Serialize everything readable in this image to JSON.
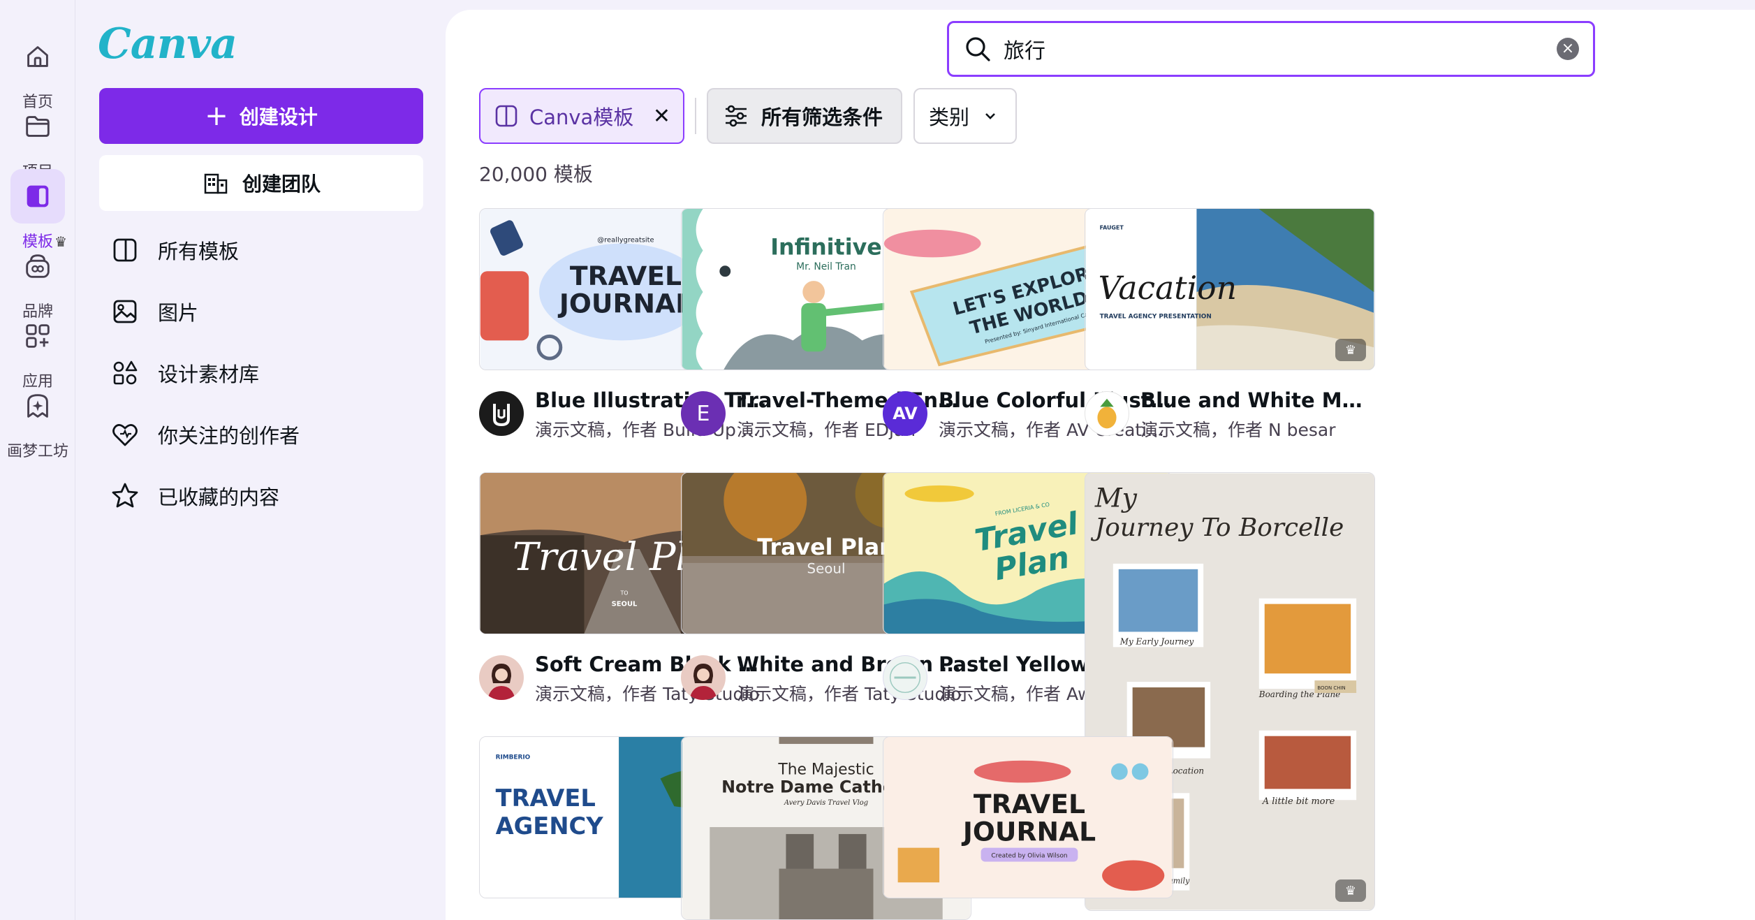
{
  "rail": {
    "items": [
      {
        "label": "首页",
        "icon": "home-icon"
      },
      {
        "label": "项目",
        "icon": "folder-icon"
      },
      {
        "label": "模板",
        "icon": "templates-icon",
        "active": true
      },
      {
        "label": "品牌",
        "icon": "brand-icon",
        "crown": true
      },
      {
        "label": "应用",
        "icon": "apps-icon"
      },
      {
        "label": "画梦工坊",
        "icon": "dream-lab-icon"
      }
    ]
  },
  "sidebar": {
    "logo": "Canva",
    "create_design": "创建设计",
    "create_team": "创建团队",
    "nav": [
      {
        "label": "所有模板",
        "icon": "templates-outline-icon"
      },
      {
        "label": "图片",
        "icon": "image-icon"
      },
      {
        "label": "设计素材库",
        "icon": "elements-icon"
      },
      {
        "label": "你关注的创作者",
        "icon": "heart-icon"
      },
      {
        "label": "已收藏的内容",
        "icon": "star-icon"
      }
    ]
  },
  "search": {
    "value": "旅行"
  },
  "filters": {
    "canva_templates": "Canva模板",
    "all_filters": "所有筛选条件",
    "category": "类别"
  },
  "results_count": "20,000 模板",
  "cards": [
    {
      "title": "Blue Illustrative Travel ...",
      "sub": "演示文稿，作者 Build Up Stu...",
      "avatar_text": "",
      "pro": false
    },
    {
      "title": "Travel-Themed English ...",
      "sub": "演示文稿，作者 EDjan",
      "avatar_text": "E",
      "pro": true
    },
    {
      "title": "Blue Colorful Illustrati...",
      "sub": "演示文稿，作者 AV Creatives",
      "avatar_text": "AV",
      "pro": false
    },
    {
      "title": "Blue and White Moder...",
      "sub": "演示文稿，作者 N besar",
      "avatar_text": "",
      "pro": true
    },
    {
      "title": "Soft Cream Black Simp...",
      "sub": "演示文稿，作者 Taty Studio",
      "avatar_text": "",
      "pro": false
    },
    {
      "title": "White and Brown Simp...",
      "sub": "演示文稿，作者 Taty Studio",
      "avatar_text": "",
      "pro": false
    },
    {
      "title": "Pastel Yellow Illustrati...",
      "sub": "演示文稿，作者 Awwa Studio",
      "avatar_text": "",
      "pro": true
    }
  ],
  "thumb_text": {
    "t1": {
      "main1": "TRAVEL",
      "main2": "JOURNAL",
      "tag": "@reallygreatsite"
    },
    "t2": {
      "main": "Infinitive",
      "sub": "Mr. Neil Tran"
    },
    "t3": {
      "main1": "LET'S EXPLORE",
      "main2": "THE WORLD!",
      "sub": "Presented by: Sinyard International Co."
    },
    "t4": {
      "brand": "FAUGET",
      "main": "Vacation",
      "sub": "TRAVEL AGENCY PRESENTATION"
    },
    "t5": {
      "main": "Travel Plan",
      "to": "TO",
      "sub": "SEOUL"
    },
    "t6": {
      "main": "Travel Plan",
      "sub": "Seoul"
    },
    "t7": {
      "main1": "Travel",
      "main2": "Plan",
      "tag": "FROM LICERIA & CO"
    },
    "t8": {
      "title1": "My",
      "title2": "Journey To Borcelle",
      "c1": "My Early Journey",
      "c2": "Boarding the Plane",
      "c3": "Travel to Location",
      "c4": "A little bit more",
      "c5": "My Beloved Family",
      "stamp": "BOON CHIN"
    },
    "t9": {
      "brand": "RIMBERIO",
      "main1": "TRAVEL",
      "main2": "AGENCY"
    },
    "t10": {
      "pre": "The Majestic",
      "main": "Notre Dame Cathedral",
      "sub": "Avery Davis Travel Vlog"
    },
    "t11": {
      "main1": "TRAVEL",
      "main2": "JOURNAL",
      "sub": "Created by Olivia Wilson"
    }
  }
}
